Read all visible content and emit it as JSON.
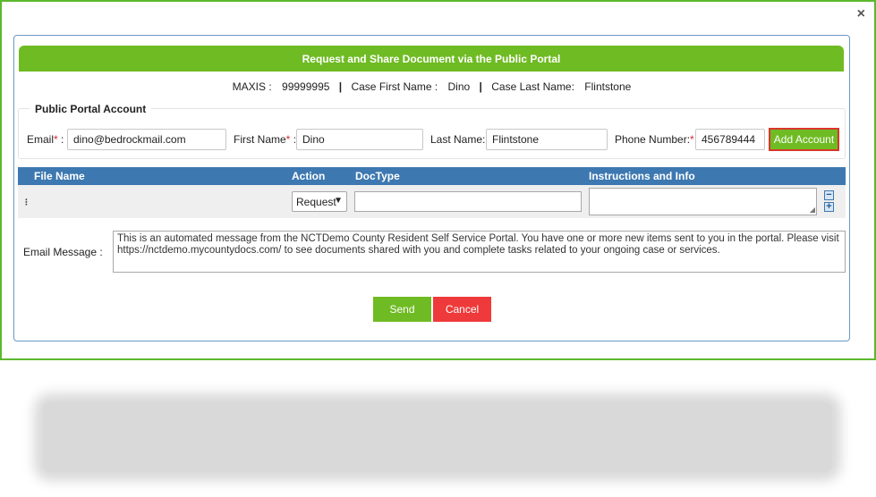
{
  "dialog": {
    "close_glyph": "×",
    "title": "Request and Share Document via the Public Portal"
  },
  "case_info": {
    "maxis_label": "MAXIS :",
    "maxis_value": "99999995",
    "first_name_label": "Case First Name :",
    "first_name_value": "Dino",
    "last_name_label": "Case Last Name:",
    "last_name_value": "Flintstone",
    "separator": "|"
  },
  "account": {
    "legend": "Public Portal Account",
    "email_label": "Email",
    "email_value": "dino@bedrockmail.com",
    "first_name_label": "First Name",
    "first_name_value": "Dino",
    "last_name_label": "Last Name:",
    "last_name_value": "Flintstone",
    "phone_label": "Phone Number:",
    "phone_value": "456789444",
    "required_mark": "*",
    "colon": ":",
    "add_button": "Add Account"
  },
  "grid": {
    "columns": [
      "File Name",
      "Action",
      "DocType",
      "Instructions and Info"
    ],
    "row": {
      "action_value": "Request",
      "doctype_value": "",
      "instructions_value": ""
    },
    "minus_glyph": "−",
    "plus_glyph": "+"
  },
  "email_message": {
    "label": "Email Message :",
    "text": "This is an automated message from the NCTDemo County Resident Self Service Portal. You have one or more new items sent to you in the portal. Please visit https://nctdemo.mycountydocs.com/ to see documents shared with you and complete tasks related to your ongoing case or services."
  },
  "actions": {
    "send": "Send",
    "cancel": "Cancel"
  },
  "colors": {
    "accent_green": "#6fbb23",
    "header_blue": "#3d78b0",
    "cancel_red": "#ee3a3a",
    "highlight_red": "#d9372b"
  }
}
